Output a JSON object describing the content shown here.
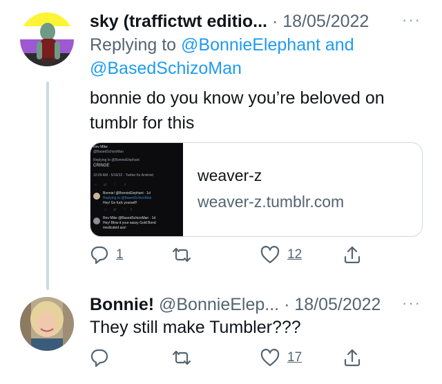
{
  "tweets": [
    {
      "display_name": "sky (traffictwt editio...",
      "separator": "·",
      "date": "18/05/2022",
      "more_label": "···",
      "reply_prefix": "Replying to",
      "reply_mention_1": "@BonnieElephant",
      "reply_and": "and",
      "reply_mention_2": "@BasedSchizoMan",
      "text_line_1": "bonnie do you know you’re beloved on",
      "text_line_2": "tumblr for this",
      "card": {
        "title": "weaver-z",
        "url": "weaver-z.tumblr.com",
        "thumb": {
          "l1": "Rev Mike",
          "l2": "@BasedSchizoMan",
          "l3": "Replying to @BonnieElephant",
          "l4": "CRINGE",
          "l5": "10:09 AM · 5/16/22 · Twitter for Android",
          "l6": "Bonnie! @BonnieElephant · 1d",
          "l7": "Replying to @BasedSchizoMan",
          "l8": "Hey! Go fuck yourself!",
          "l9": "Rev Mike @BasedSchizoMan · 1d",
          "l10": "Hey! Blow it your sassy Gold Bond",
          "l11": "medicated ass!"
        }
      },
      "actions": {
        "replies": "1",
        "retweets": "",
        "likes": "12"
      }
    },
    {
      "display_name": "Bonnie!",
      "handle": "@BonnieElep...",
      "separator": "·",
      "date": "18/05/2022",
      "more_label": "···",
      "text_line_1": "They still make Tumbler???",
      "actions": {
        "replies": "",
        "retweets": "",
        "likes": "17"
      }
    }
  ],
  "colors": {
    "link": "#1d9bf0",
    "secondary": "#536471",
    "border": "#cfd9de"
  },
  "icons": [
    "reply-icon",
    "retweet-icon",
    "like-icon",
    "share-icon",
    "more-icon"
  ]
}
